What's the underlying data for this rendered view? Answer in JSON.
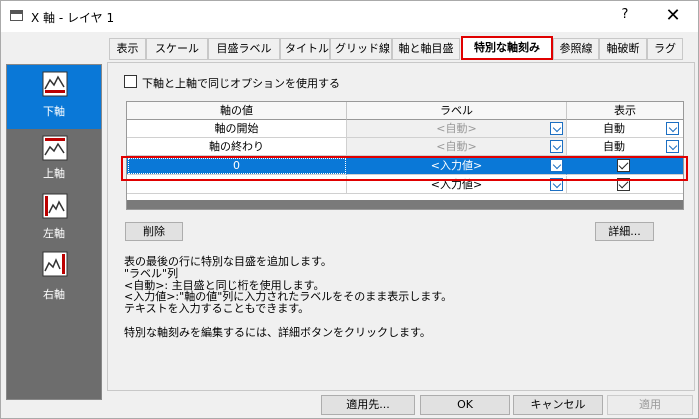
{
  "window": {
    "title": "X 軸 - レイヤ 1",
    "help": "?",
    "close": "✕"
  },
  "axes": [
    {
      "label": "下軸",
      "active": true
    },
    {
      "label": "上軸",
      "active": false
    },
    {
      "label": "左軸",
      "active": false
    },
    {
      "label": "右軸",
      "active": false
    }
  ],
  "tabs": [
    "表示",
    "スケール",
    "目盛ラベル",
    "タイトル",
    "グリッド線",
    "軸と軸目盛",
    "特別な軸刻み",
    "参照線",
    "軸破断",
    "ラグ"
  ],
  "active_tab": "特別な軸刻み",
  "same_option": {
    "label": "下軸と上軸で同じオプションを使用する",
    "checked": false
  },
  "grid": {
    "headers": [
      "軸の値",
      "ラベル",
      "表示"
    ],
    "rows": [
      {
        "value": "軸の開始",
        "label": "<自動>",
        "display": "自動"
      },
      {
        "value": "軸の終わり",
        "label": "<自動>",
        "display": "自動"
      },
      {
        "value": "0",
        "label": "<入力値>",
        "display": ""
      },
      {
        "value": "",
        "label": "<入力値>",
        "display": ""
      }
    ]
  },
  "buttons": {
    "delete": "削除",
    "details": "詳細..."
  },
  "description": [
    "表の最後の行に特別な目盛を追加します。",
    "\"ラベル\"列",
    "<自動>: 主目盛と同じ桁を使用します。",
    "<入力値>:\"軸の値\"列に入力されたラベルをそのまま表示します。",
    "テキストを入力することもできます。",
    "",
    "特別な軸刻みを編集するには、詳細ボタンをクリックします。"
  ],
  "footer": {
    "apply_to": "適用先...",
    "ok": "OK",
    "cancel": "キャンセル",
    "apply": "適用"
  },
  "colors": {
    "selection": "#0a78d7",
    "highlight": "#e00000"
  }
}
